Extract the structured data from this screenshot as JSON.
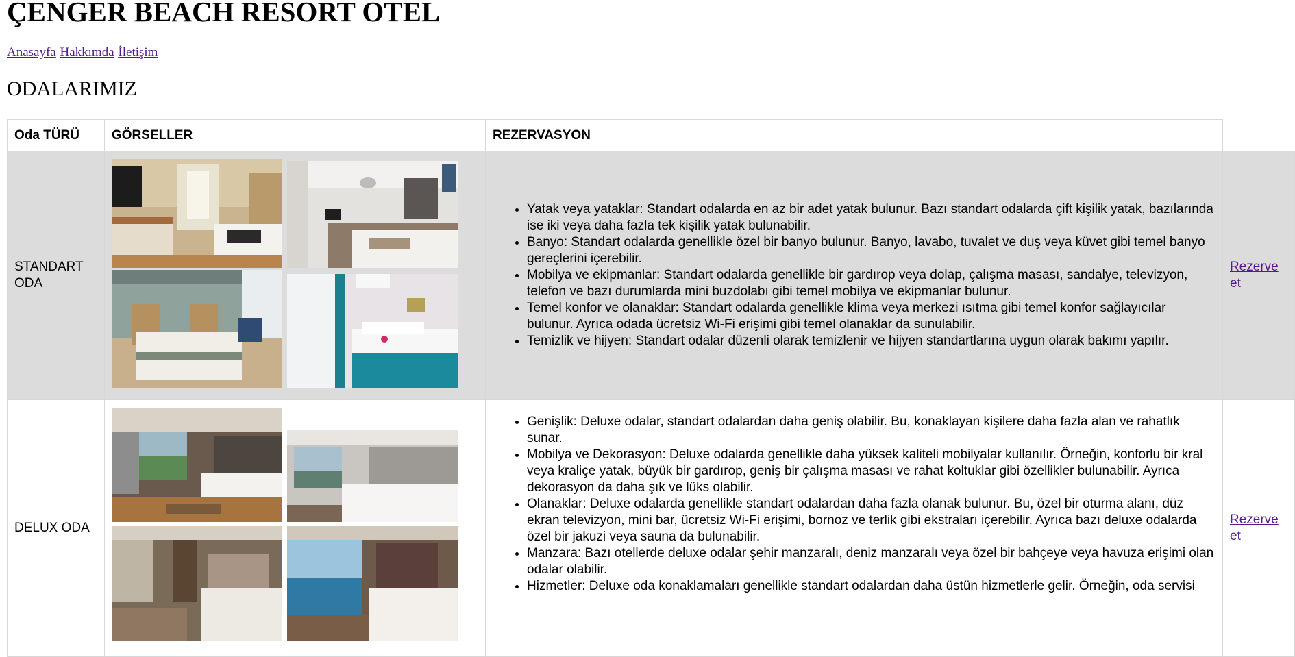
{
  "site": {
    "title": "ÇENGER BEACH RESORT OTEL"
  },
  "nav": {
    "home": "Anasayfa",
    "about": "Hakkımda",
    "contact": "İletişim"
  },
  "section": {
    "title": "ODALARIMIZ"
  },
  "table": {
    "headers": [
      "Oda TÜRÜ",
      "GÖRSELLER",
      "REZERVASYON"
    ],
    "rows": [
      {
        "type": "STANDART ODA",
        "bullets": [
          "Yatak veya yataklar: Standart odalarda en az bir adet yatak bulunur. Bazı standart odalarda çift kişilik yatak, bazılarında ise iki veya daha fazla tek kişilik yatak bulunabilir.",
          "Banyo: Standart odalarda genellikle özel bir banyo bulunur. Banyo, lavabo, tuvalet ve duş veya küvet gibi temel banyo gereçlerini içerebilir.",
          "Mobilya ve ekipmanlar: Standart odalarda genellikle bir gardırop veya dolap, çalışma masası, sandalye, televizyon, telefon ve bazı durumlarda mini buzdolabı gibi temel mobilya ve ekipmanlar bulunur.",
          "Temel konfor ve olanaklar: Standart odalarda genellikle klima veya merkezi ısıtma gibi temel konfor sağlayıcılar bulunur. Ayrıca odada ücretsiz Wi-Fi erişimi gibi temel olanaklar da sunulabilir.",
          "Temizlik ve hijyen: Standart odalar düzenli olarak temizlenir ve hijyen standartlarına uygun olarak bakımı yapılır."
        ],
        "reserve": "Rezerve et"
      },
      {
        "type": "DELUX ODA",
        "bullets": [
          "Genişlik: Deluxe odalar, standart odalardan daha geniş olabilir. Bu, konaklayan kişilere daha fazla alan ve rahatlık sunar.",
          "Mobilya ve Dekorasyon: Deluxe odalarda genellikle daha yüksek kaliteli mobilyalar kullanılır. Örneğin, konforlu bir kral veya kraliçe yatak, büyük bir gardırop, geniş bir çalışma masası ve rahat koltuklar gibi özellikler bulunabilir. Ayrıca dekorasyon da daha şık ve lüks olabilir.",
          "Olanaklar: Deluxe odalarda genellikle standart odalardan daha fazla olanak bulunur. Bu, özel bir oturma alanı, düz ekran televizyon, mini bar, ücretsiz Wi-Fi erişimi, bornoz ve terlik gibi ekstraları içerebilir. Ayrıca bazı deluxe odalarda özel bir jakuzi veya sauna da bulunabilir.",
          "Manzara: Bazı otellerde deluxe odalar şehir manzaralı, deniz manzaralı veya özel bir bahçeye veya havuza erişimi olan odalar olabilir.",
          "Hizmetler: Deluxe oda konaklamaları genellikle standart odalardan daha üstün hizmetlerle gelir. Örneğin, oda servisi"
        ],
        "reserve": "Rezerve et"
      }
    ]
  },
  "colors": {
    "link": "#551a8b",
    "row_alt_bg": "#dcdcdc",
    "border": "#d7d7d7"
  }
}
